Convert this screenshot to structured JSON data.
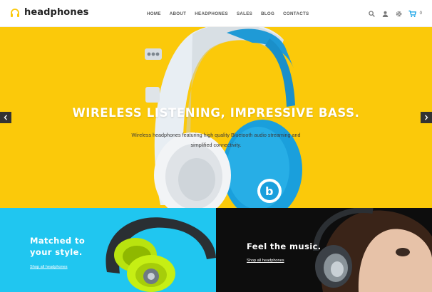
{
  "brand": {
    "name": "headphones",
    "accent": "#fbc90a"
  },
  "nav": {
    "items": [
      {
        "label": "HOME"
      },
      {
        "label": "ABOUT"
      },
      {
        "label": "HEADPHONES"
      },
      {
        "label": "SALES"
      },
      {
        "label": "BLOG"
      },
      {
        "label": "CONTACTS"
      }
    ]
  },
  "tools": {
    "search_icon": "search-icon",
    "account_icon": "user-icon",
    "settings_icon": "gear-icon",
    "cart_icon": "cart-icon",
    "cart_count": "0",
    "cart_color": "#1ea6e8"
  },
  "hero": {
    "title": "WIRELESS LISTENING, IMPRESSIVE BASS.",
    "subtitle": "Wireless headphones featuring high quality Bluetooth audio streaming and simplified connectivity.",
    "background": "#fbc90a",
    "prev_icon": "chevron-left-icon",
    "next_icon": "chevron-right-icon"
  },
  "promos": {
    "left": {
      "title": "Matched to your style.",
      "link": "Shop all headphones",
      "background": "#20c6f0"
    },
    "right": {
      "title": "Feel the music.",
      "link": "Shop all headphones",
      "background": "#0d0d0d"
    }
  }
}
